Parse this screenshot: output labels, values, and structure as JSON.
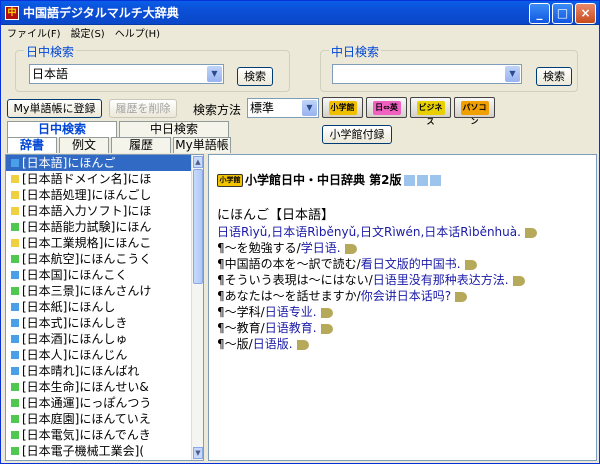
{
  "titlebar": {
    "title": "中国語デジタルマルチ大辞典",
    "minimize": "_",
    "maximize": "□",
    "close": "×"
  },
  "menu": [
    "ファイル(F)",
    "設定(S)",
    "ヘルプ(H)"
  ],
  "jc_search": {
    "group_label": "日中検索",
    "value": "日本語",
    "button": "検索"
  },
  "cj_search": {
    "group_label": "中日検索",
    "value": "",
    "button": "検索"
  },
  "toolbar": {
    "add_button": "My単語帳に登録",
    "delete_button": "履歴を削除",
    "method_label": "検索方法",
    "method_value": "標準",
    "dict_buttons": [
      {
        "name": "shogakukan",
        "label": "小学館",
        "color": "#f0c000"
      },
      {
        "name": "nichiei",
        "label": "日⇔英",
        "color": "#f060c0"
      },
      {
        "name": "business",
        "label": "ビジネス",
        "color": "#e8d000"
      },
      {
        "name": "computer",
        "label": "パソコン",
        "color": "#f0a000"
      }
    ],
    "appendix_button": "小学館付録"
  },
  "tabs_top": [
    "日中検索",
    "中日検索"
  ],
  "tabs_bottom": [
    "辞書",
    "例文",
    "履歴",
    "My単語帳"
  ],
  "list": [
    {
      "text": "[日本語]にほんご",
      "color": "#4aa0e8"
    },
    {
      "text": "[日本語ドメイン名]にほ",
      "color": "#f0d040"
    },
    {
      "text": "[日本語処理]にほんごし",
      "color": "#f0d040"
    },
    {
      "text": "[日本語入力ソフト]にほ",
      "color": "#f0d040"
    },
    {
      "text": "[日本語能力試験]にほん",
      "color": "#50c850"
    },
    {
      "text": "[日本工業規格]にほんこ",
      "color": "#f0d040"
    },
    {
      "text": "[日本航空]にほんこうく",
      "color": "#50c850"
    },
    {
      "text": "[日本国]にほんこく",
      "color": "#4aa0e8"
    },
    {
      "text": "[日本三景]にほんさんけ",
      "color": "#50c850"
    },
    {
      "text": "[日本紙]にほんし",
      "color": "#4aa0e8"
    },
    {
      "text": "[日本式]にほんしき",
      "color": "#4aa0e8"
    },
    {
      "text": "[日本酒]にほんしゅ",
      "color": "#4aa0e8"
    },
    {
      "text": "[日本人]にほんじん",
      "color": "#4aa0e8"
    },
    {
      "text": "[日本晴れ]にほんばれ",
      "color": "#4aa0e8"
    },
    {
      "text": "[日本生命]にほんせい&",
      "color": "#50c850"
    },
    {
      "text": "[日本通運]にっぽんつう",
      "color": "#50c850"
    },
    {
      "text": "[日本庭園]にほんていえ",
      "color": "#50c850"
    },
    {
      "text": "[日本電気]にほんでんき",
      "color": "#50c850"
    },
    {
      "text": "[日本電子機械工業会](",
      "color": "#50c850"
    }
  ],
  "content": {
    "logo": "小学館",
    "dictionary_title": "小学館日中・中日辞典 第2版",
    "headword": "にほんご【日本語】",
    "translation": "日语Rìyǔ,日本语Rìběnyǔ,日文Rìwén,日本话Rìběnhuà.",
    "examples": [
      {
        "jp": "¶～を勉強する",
        "cn": "学日语."
      },
      {
        "jp": "¶中国語の本を～訳で読む",
        "cn": "看日文版的中国书."
      },
      {
        "jp": "¶そういう表現は～にはない",
        "cn": "日语里没有那种表达方法."
      },
      {
        "jp": "¶あなたは～を話せますか",
        "cn": "你会讲日本话吗?"
      },
      {
        "jp": "¶～学科",
        "cn": "日语专业."
      },
      {
        "jp": "¶～教育",
        "cn": "日语教育."
      },
      {
        "jp": "¶～版",
        "cn": "日语版."
      }
    ]
  }
}
